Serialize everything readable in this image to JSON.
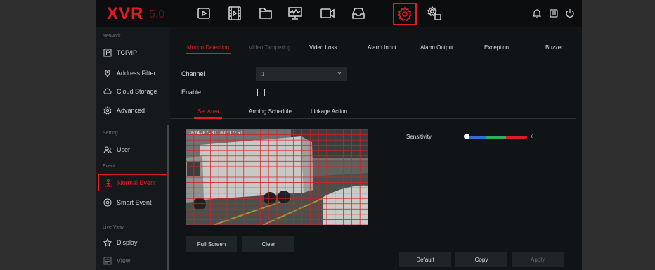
{
  "app": {
    "logo": "XVR",
    "version": "5.0"
  },
  "topnav": {
    "icons": [
      "playback-icon",
      "film-icon",
      "folder-icon",
      "monitor-graph-icon",
      "camera-icon",
      "inbox-icon",
      "settings-gear-icon",
      "system-gear-icon"
    ],
    "active": "settings-gear-icon",
    "right_icons": [
      "bell-icon",
      "disk-icon",
      "power-icon"
    ]
  },
  "sidebar": {
    "sections": {
      "network": "Network",
      "setting": "Setting",
      "event": "Event",
      "live_view": "Live View"
    },
    "items": [
      {
        "label": "TCP/IP",
        "icon": "p-box-icon"
      },
      {
        "label": "Address Filter",
        "icon": "location-pin-icon"
      },
      {
        "label": "Cloud Storage",
        "icon": "cloud-icon"
      },
      {
        "label": "Advanced",
        "icon": "network-gear-icon"
      },
      {
        "label": "User",
        "icon": "users-icon"
      },
      {
        "label": "Normal Event",
        "icon": "person-alert-icon",
        "active": true
      },
      {
        "label": "Smart Event",
        "icon": "smart-event-icon"
      },
      {
        "label": "Display",
        "icon": "star-icon"
      },
      {
        "label": "View",
        "icon": "view-icon"
      }
    ]
  },
  "tabs": [
    "Motion Detection",
    "Video Tampering",
    "Video Loss",
    "Alarm Input",
    "Alarm Output",
    "Exception",
    "Buzzer"
  ],
  "active_tab": "Motion Detection",
  "form": {
    "channel_label": "Channel",
    "channel_value": "1",
    "enable_label": "Enable",
    "enable_checked": false
  },
  "subtabs": [
    "Set Area",
    "Arming Schedule",
    "Linkage Action"
  ],
  "active_subtab": "Set Area",
  "video": {
    "timestamp": "2024-07-01 07:17:51"
  },
  "sensitivity": {
    "label": "Sensitivity",
    "value": "0"
  },
  "buttons": {
    "full_screen": "Full Screen",
    "clear": "Clear",
    "default": "Default",
    "copy": "Copy",
    "apply": "Apply"
  },
  "colors": {
    "accent": "#e01d24",
    "background": "#111416",
    "sidebar": "#16191b"
  }
}
